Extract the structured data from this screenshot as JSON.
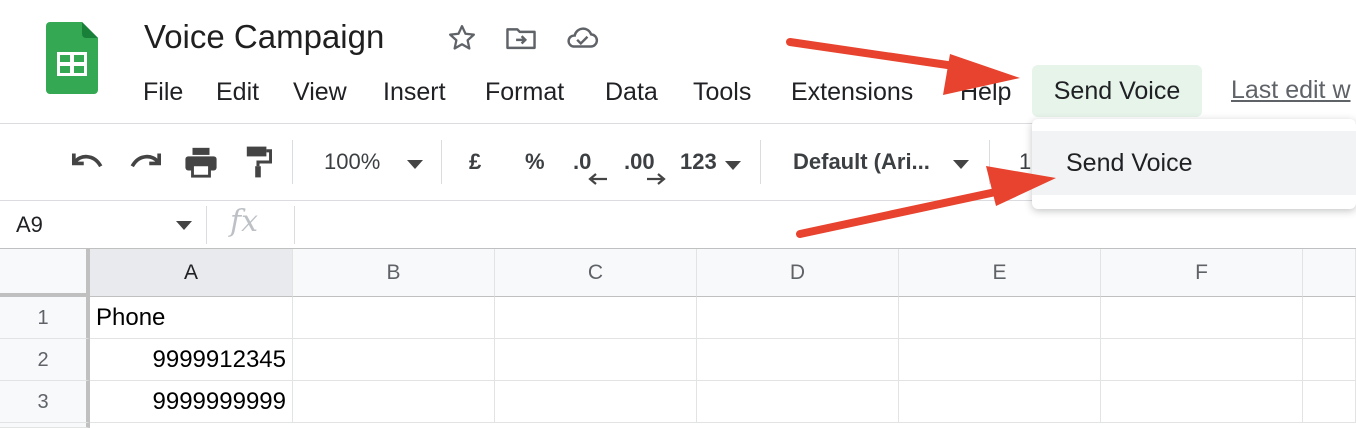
{
  "doc": {
    "title": "Voice Campaign"
  },
  "icons": {
    "app": "google-sheets-icon",
    "star": "star-icon",
    "move": "move-to-folder-icon",
    "cloud": "cloud-saved-icon"
  },
  "menu": {
    "items": [
      "File",
      "Edit",
      "View",
      "Insert",
      "Format",
      "Data",
      "Tools",
      "Extensions",
      "Help",
      "Send Voice"
    ],
    "last_edit": "Last edit w"
  },
  "toolbar": {
    "zoom": "100%",
    "currency": "£",
    "percent": "%",
    "decrease_decimal": ".0",
    "increase_decimal": ".00",
    "number_format": "123",
    "font": "Default (Ari...",
    "font_size": "1"
  },
  "formula_bar": {
    "name_box": "A9",
    "fx": "fx"
  },
  "grid": {
    "columns": [
      "A",
      "B",
      "C",
      "D",
      "E",
      "F"
    ],
    "rows": [
      {
        "num": "1",
        "A": "Phone"
      },
      {
        "num": "2",
        "A": "9999912345"
      },
      {
        "num": "3",
        "A": "9999999999"
      }
    ]
  },
  "dropdown": {
    "items": [
      "Send Voice"
    ]
  },
  "colors": {
    "accent_green": "#0f9d58",
    "menu_highlight": "#e6f4ea",
    "arrow_red": "#e8432e"
  }
}
